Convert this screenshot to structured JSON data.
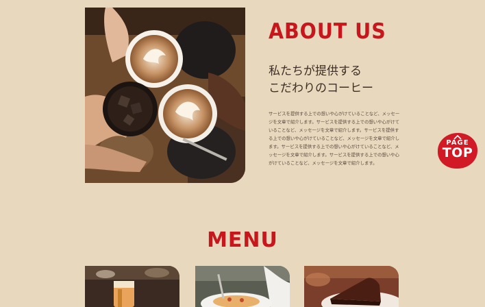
{
  "about": {
    "title": "ABOUT US",
    "subtitle_line1": "私たちが提供する",
    "subtitle_line2": "こだわりのコーヒー",
    "body": "サービスを提供する上での想いや心がけていることなど、メッセージを文章で紹介します。サービスを提供する上での想いや心がけていることなど、メッセージを文章で紹介します。サービスを提供する上での想いや心がけていることなど、メッセージを文章で紹介します。サービスを提供する上での想いや心がけていることなど、メッセージを文章で紹介します。サービスを提供する上での想いや心がけていることなど、メッセージを文章で紹介します。"
  },
  "menu": {
    "heading": "MENU"
  },
  "page_top": {
    "line1": "PAGE",
    "line2": "TOP"
  },
  "colors": {
    "background": "#e8d8bd",
    "accent": "#c8161d",
    "text": "#3e2f26"
  }
}
